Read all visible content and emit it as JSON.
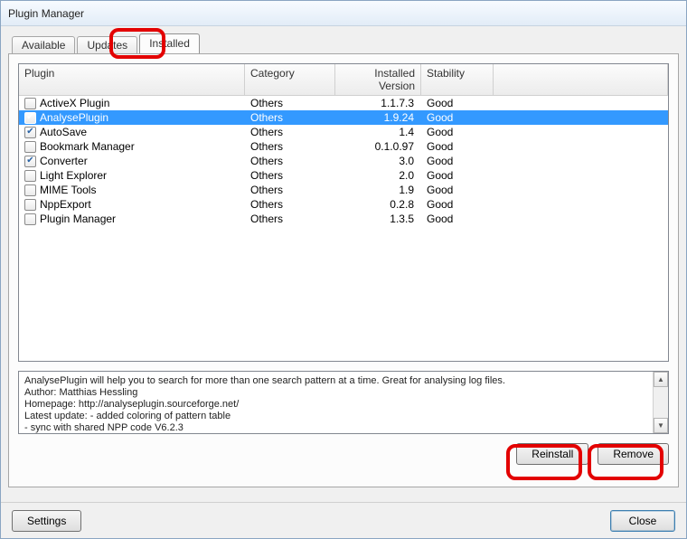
{
  "window": {
    "title": "Plugin Manager"
  },
  "tabs": {
    "available": "Available",
    "updates": "Updates",
    "installed": "Installed"
  },
  "columns": {
    "plugin": "Plugin",
    "category": "Category",
    "version": "Installed Version",
    "stability": "Stability"
  },
  "plugins": [
    {
      "name": "ActiveX Plugin",
      "category": "Others",
      "version": "1.1.7.3",
      "stability": "Good",
      "checked": false,
      "selected": false
    },
    {
      "name": "AnalysePlugin",
      "category": "Others",
      "version": "1.9.24",
      "stability": "Good",
      "checked": true,
      "selected": true
    },
    {
      "name": "AutoSave",
      "category": "Others",
      "version": "1.4",
      "stability": "Good",
      "checked": true,
      "selected": false
    },
    {
      "name": "Bookmark Manager",
      "category": "Others",
      "version": "0.1.0.97",
      "stability": "Good",
      "checked": false,
      "selected": false
    },
    {
      "name": "Converter",
      "category": "Others",
      "version": "3.0",
      "stability": "Good",
      "checked": true,
      "selected": false
    },
    {
      "name": "Light Explorer",
      "category": "Others",
      "version": "2.0",
      "stability": "Good",
      "checked": false,
      "selected": false
    },
    {
      "name": "MIME Tools",
      "category": "Others",
      "version": "1.9",
      "stability": "Good",
      "checked": false,
      "selected": false
    },
    {
      "name": "NppExport",
      "category": "Others",
      "version": "0.2.8",
      "stability": "Good",
      "checked": false,
      "selected": false
    },
    {
      "name": "Plugin Manager",
      "category": "Others",
      "version": "1.3.5",
      "stability": "Good",
      "checked": false,
      "selected": false
    }
  ],
  "description": {
    "line1": "AnalysePlugin will help you to search for more than one search pattern at a time. Great for analysing log files.",
    "line2": "Author: Matthias Hessling",
    "line3": "Homepage: http://analyseplugin.sourceforge.net/",
    "line4": "Latest update: - added coloring of pattern table",
    "line5": "  - sync with shared NPP code V6.2.3"
  },
  "buttons": {
    "reinstall": "Reinstall",
    "remove": "Remove",
    "settings": "Settings",
    "close": "Close"
  }
}
